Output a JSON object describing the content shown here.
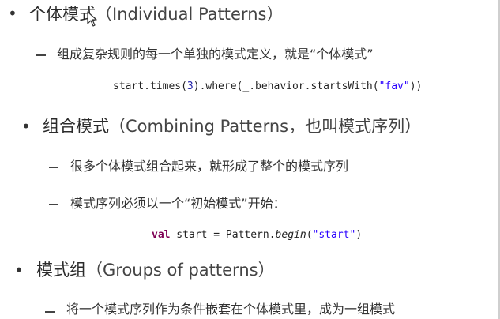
{
  "section1": {
    "heading": "个体模式",
    "heading_en": "（Individual Patterns）",
    "item1": "组成复杂规则的每一个单独的模式定义，就是“个体模式”",
    "code": {
      "p1": "start.times(",
      "num": "3",
      "p2": ").where(_.behavior.startsWith(",
      "str": "\"fav\"",
      "p3": "))"
    }
  },
  "section2": {
    "heading": "组合模式",
    "heading_en": "（Combining Patterns，也叫模式序列）",
    "item1": "很多个体模式组合起来，就形成了整个的模式序列",
    "item2": "模式序列必须以一个“初始模式”开始：",
    "code": {
      "kw": "val",
      "p1": " start = Pattern.",
      "method": "begin",
      "p2": "(",
      "str": "\"start\"",
      "p3": ")"
    }
  },
  "section3": {
    "heading": "模式组",
    "heading_en": "（Groups of patterns）",
    "item1": "将一个模式序列作为条件嵌套在个体模式里，成为一组模式"
  },
  "icons": {
    "bullet": "•",
    "cursor": "mouse-pointer-icon"
  },
  "colors": {
    "keyword": "#7f0055",
    "number": "#1a1aa6",
    "string": "#2a00ff"
  }
}
